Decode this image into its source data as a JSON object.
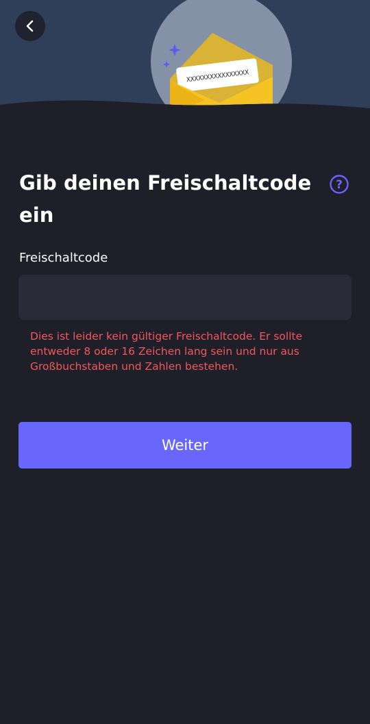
{
  "header": {
    "envelope_code": "XXXXXXXXXXXXXXXX",
    "back_icon": "chevron-left-icon"
  },
  "main": {
    "title": "Gib deinen Freischaltcode ein",
    "help_icon": "question-circle-icon",
    "field_label": "Freischaltcode",
    "input_value": "",
    "input_placeholder": "",
    "error_message": "Dies ist leider kein gültiger Freischaltcode. Er sollte entweder 8 oder 16 Zeichen lang sein und nur aus Großbuchstaben und Zahlen bestehen.",
    "continue_label": "Weiter"
  },
  "colors": {
    "background": "#1e1f29",
    "header_background": "#2f3f5a",
    "input_background": "#292b38",
    "accent": "#6866fb",
    "error": "#f2585b",
    "envelope": "#f6c325"
  }
}
